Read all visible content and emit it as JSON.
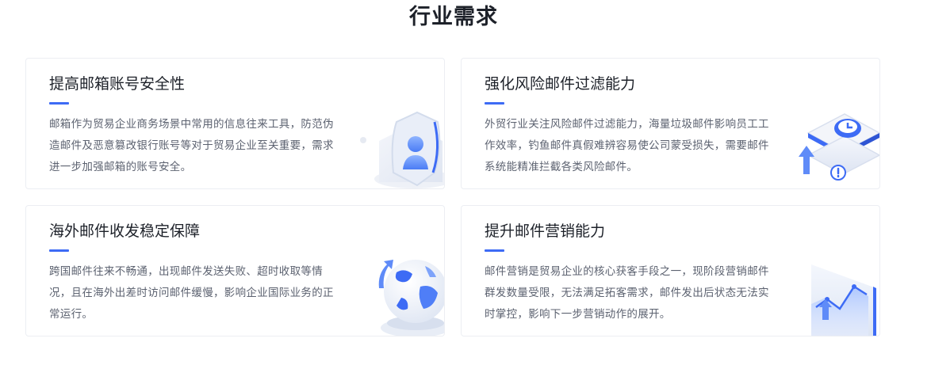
{
  "section": {
    "title": "行业需求"
  },
  "cards": [
    {
      "title": "提高邮箱账号安全性",
      "description": "邮箱作为贸易企业商务场景中常用的信息往来工具，防范伪造邮件及恶意篡改银行账号等对于贸易企业至关重要，需求进一步加强邮箱的账号安全。",
      "icon": "security-shield-icon"
    },
    {
      "title": "强化风险邮件过滤能力",
      "description": "外贸行业关注风险邮件过滤能力，海量垃圾邮件影响员工工作效率，钓鱼邮件真假难辨容易使公司蒙受损失，需要邮件系统能精准拦截各类风险邮件。",
      "icon": "filter-alert-icon"
    },
    {
      "title": "海外邮件收发稳定保障",
      "description": "跨国邮件往来不畅通，出现邮件发送失败、超时收取等情况，且在海外出差时访问邮件缓慢，影响企业国际业务的正常运行。",
      "icon": "globe-icon"
    },
    {
      "title": "提升邮件营销能力",
      "description": "邮件营销是贸易企业的核心获客手段之一，现阶段营销邮件群发数量受限，无法满足拓客需求，邮件发出后状态无法实时掌控，影响下一步营销动作的展开。",
      "icon": "marketing-chart-icon"
    }
  ],
  "colors": {
    "accent": "#3d6bf5",
    "title": "#1d2129",
    "text": "#5c6270"
  }
}
